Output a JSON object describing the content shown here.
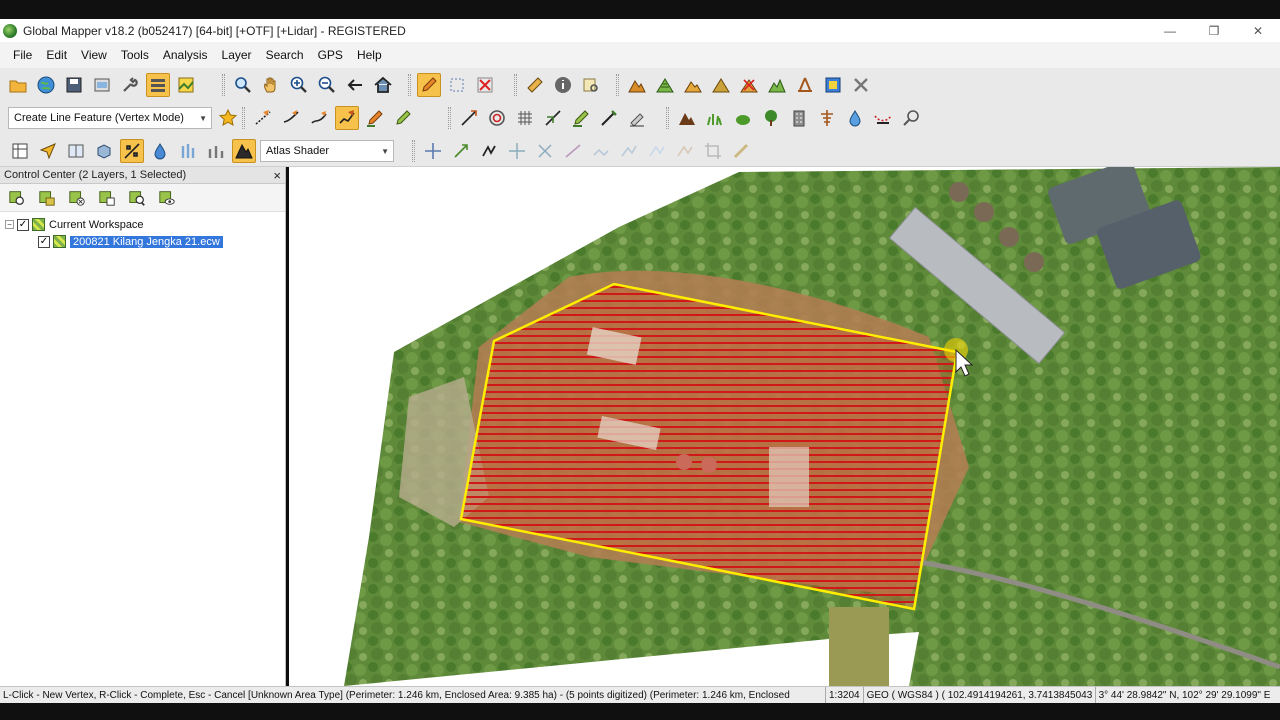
{
  "window": {
    "title": "Global Mapper v18.2 (b052417) [64-bit] [+OTF] [+Lidar] - REGISTERED",
    "minimize": "—",
    "restore": "❐",
    "close": "✕"
  },
  "menu": [
    "File",
    "Edit",
    "View",
    "Tools",
    "Analysis",
    "Layer",
    "Search",
    "GPS",
    "Help"
  ],
  "toolbar": {
    "digitizer_mode": "Create Line Feature (Vertex Mode)",
    "shader": "Atlas Shader"
  },
  "control_center": {
    "title": "Control Center (2 Layers, 1 Selected)",
    "close": "×",
    "workspace_label": "Current Workspace",
    "expander": "−",
    "check": "✓",
    "layer_name": "200821 Kilang Jengka 21.ecw"
  },
  "status": {
    "hint": "L-Click - New Vertex, R-Click - Complete, Esc - Cancel [Unknown Area Type] (Perimeter: 1.246 km, Enclosed Area: 9.385 ha) - (5 points digitized) (Perimeter: 1.246 km, Enclosed",
    "scale": "1:3204",
    "projection": "GEO ( WGS84 ) ( 102.4914194261, 3.7413845043",
    "coords": "3° 44' 28.9842\" N, 102° 29' 29.1099\" E"
  },
  "colors": {
    "active_tool": "#f6c24b",
    "polygon_outline": "#ffee00",
    "hatch": "#cc1111",
    "selection": "#3377dd"
  }
}
